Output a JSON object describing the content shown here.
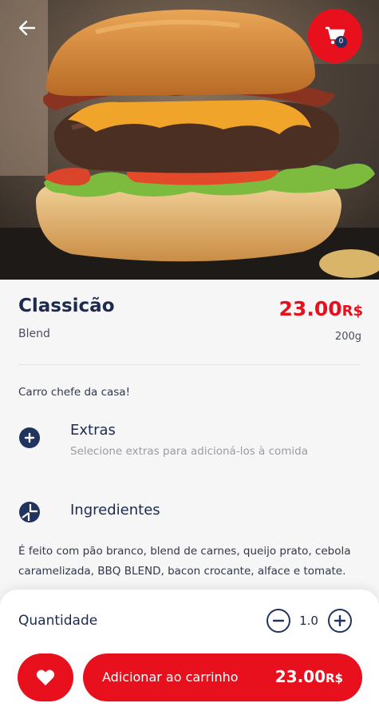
{
  "header": {
    "back_icon": "arrow-left-icon",
    "cart_icon": "shopping-cart-icon",
    "cart_count": "0"
  },
  "product": {
    "name": "Classicão",
    "type": "Blend",
    "price_value": "23.00",
    "price_currency": "R$",
    "weight": "200g",
    "description": "Carro chefe da casa!"
  },
  "extras": {
    "icon": "plus-circle-icon",
    "title": "Extras",
    "subtitle": "Selecione extras para adicioná-los à comida"
  },
  "ingredients": {
    "icon": "pie-chart-icon",
    "title": "Ingredientes",
    "text": "É feito com pão branco, blend de carnes, queijo prato, cebola caramelizada, BBQ BLEND, bacon crocante, alface e tomate."
  },
  "cart_bar": {
    "quantity_label": "Quantidade",
    "quantity_value": "1.0",
    "add_label": "Adicionar ao carrinho",
    "add_price_value": "23.00",
    "add_price_currency": "R$",
    "favorite_icon": "heart-icon"
  },
  "colors": {
    "accent": "#e8101c",
    "navy": "#20345f"
  }
}
